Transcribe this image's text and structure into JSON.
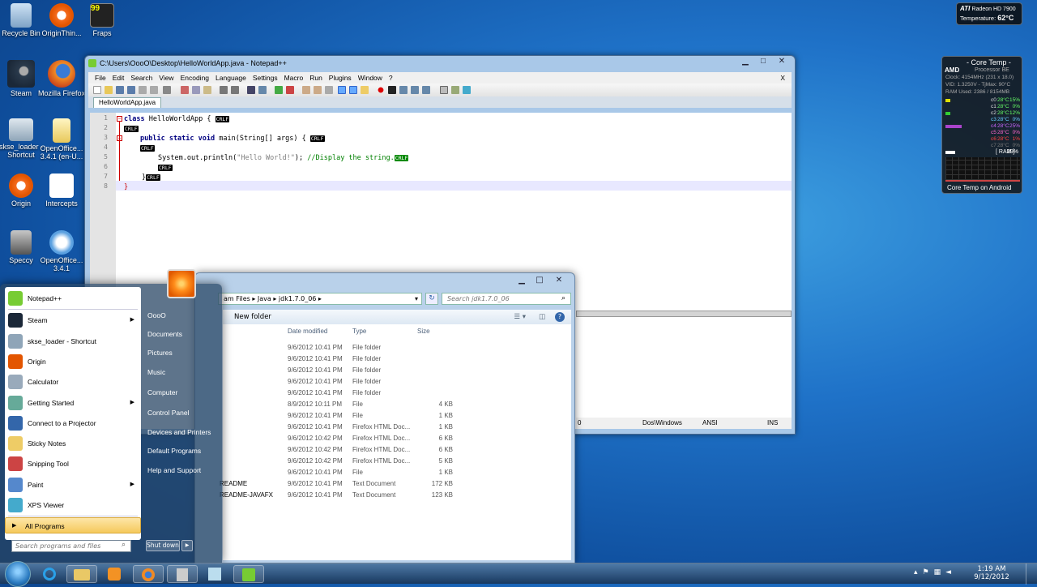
{
  "desktop_icons": [
    {
      "label": "Recycle Bin",
      "icon": "recycle-bin-icon"
    },
    {
      "label": "OriginThin...",
      "icon": "origin-icon"
    },
    {
      "label": "Fraps",
      "icon": "fraps-icon"
    },
    {
      "label": "Steam",
      "icon": "steam-icon"
    },
    {
      "label": "Mozilla Firefox",
      "icon": "firefox-icon"
    },
    {
      "label": "skse_loader - Shortcut",
      "icon": "skse-icon"
    },
    {
      "label": "OpenOffice... 3.4.1 (en-U...",
      "icon": "openoffice-folder-icon"
    },
    {
      "label": "Origin",
      "icon": "origin-icon"
    },
    {
      "label": "Intercepts",
      "icon": "intercepts-icon"
    },
    {
      "label": "Speccy",
      "icon": "speccy-icon"
    },
    {
      "label": "OpenOffice... 3.4.1",
      "icon": "openoffice-icon"
    }
  ],
  "fraps_counter": "99",
  "gpu_gadget": {
    "brand": "ATI",
    "model": "Radeon HD 7900",
    "temp_label": "Temperature:",
    "temp_value": "62°C"
  },
  "coretemp_gadget": {
    "title": "- Core Temp -",
    "processor": "Processor BE",
    "brand": "AMD",
    "clock": "Clock: 4154MHz (231 x 18.0)",
    "vid": "VID: 1.3250V - TjMax: 90°C",
    "ram_used": "RAM Used: 2386 / 8154MB",
    "cores": [
      {
        "name": "c0",
        "temp": "28°C",
        "load": "15%"
      },
      {
        "name": "c1",
        "temp": "28°C",
        "load": "0%"
      },
      {
        "name": "c2",
        "temp": "28°C",
        "load": "12%"
      },
      {
        "name": "c3",
        "temp": "28°C",
        "load": "0%"
      },
      {
        "name": "c4",
        "temp": "28°C",
        "load": "25%"
      },
      {
        "name": "c5",
        "temp": "28°C",
        "load": "0%"
      },
      {
        "name": "c6",
        "temp": "28°C",
        "load": "1%"
      },
      {
        "name": "c7",
        "temp": "28°C",
        "load": "0%"
      }
    ],
    "ram_label": "[ RAM ]",
    "ram_pct": "29%",
    "footer": "Core Temp on Android"
  },
  "notepad": {
    "title": "C:\\Users\\OooO\\Desktop\\HelloWorldApp.java - Notepad++",
    "menu": [
      "File",
      "Edit",
      "Search",
      "View",
      "Encoding",
      "Language",
      "Settings",
      "Macro",
      "Run",
      "Plugins",
      "Window",
      "?"
    ],
    "close_x": "X",
    "tab": "HelloWorldApp.java",
    "line_numbers": [
      "1",
      "2",
      "3",
      "4",
      "5",
      "6",
      "7",
      "8"
    ],
    "code": {
      "l1_kw": "class",
      "l1_rest": " HelloWorldApp {",
      "l3_kw": "public static void",
      "l3_rest": " main(String[] args) {",
      "l5_pre": "System.out.println(",
      "l5_str": "\"Hello World!\"",
      "l5_post": "); ",
      "l5_cmt": "//Display the string.",
      "l6": "}",
      "l7": "}",
      "l8": "}",
      "crlf": "CRLF"
    },
    "status": {
      "lines": "0",
      "eol": "Dos\\Windows",
      "enc": "ANSI",
      "mode": "INS"
    }
  },
  "explorer": {
    "breadcrumb": [
      "am Files",
      "Java",
      "jdk1.7.0_06"
    ],
    "search_placeholder": "Search jdk1.7.0_06",
    "new_folder": "New folder",
    "columns": {
      "date": "Date modified",
      "type": "Type",
      "size": "Size"
    },
    "rows": [
      {
        "name": "",
        "date": "9/6/2012 10:41 PM",
        "type": "File folder",
        "size": ""
      },
      {
        "name": "",
        "date": "9/6/2012 10:41 PM",
        "type": "File folder",
        "size": ""
      },
      {
        "name": "",
        "date": "9/6/2012 10:41 PM",
        "type": "File folder",
        "size": ""
      },
      {
        "name": "",
        "date": "9/6/2012 10:41 PM",
        "type": "File folder",
        "size": ""
      },
      {
        "name": "",
        "date": "9/6/2012 10:41 PM",
        "type": "File folder",
        "size": ""
      },
      {
        "name": "",
        "date": "8/9/2012 10:11 PM",
        "type": "File",
        "size": "4 KB"
      },
      {
        "name": "",
        "date": "9/6/2012 10:41 PM",
        "type": "File",
        "size": "1 KB"
      },
      {
        "name": "",
        "date": "9/6/2012 10:41 PM",
        "type": "Firefox HTML Doc...",
        "size": "1 KB"
      },
      {
        "name": "",
        "date": "9/6/2012 10:42 PM",
        "type": "Firefox HTML Doc...",
        "size": "6 KB"
      },
      {
        "name": "",
        "date": "9/6/2012 10:42 PM",
        "type": "Firefox HTML Doc...",
        "size": "6 KB"
      },
      {
        "name": "",
        "date": "9/6/2012 10:42 PM",
        "type": "Firefox HTML Doc...",
        "size": "5 KB"
      },
      {
        "name": "",
        "date": "9/6/2012 10:41 PM",
        "type": "File",
        "size": "1 KB"
      },
      {
        "name": "README",
        "date": "9/6/2012 10:41 PM",
        "type": "Text Document",
        "size": "172 KB"
      },
      {
        "name": "README-JAVAFX",
        "date": "9/6/2012 10:41 PM",
        "type": "Text Document",
        "size": "123 KB"
      }
    ]
  },
  "start_menu": {
    "programs": [
      {
        "label": "Notepad++",
        "icon": "notepadpp-icon",
        "arrow": false
      },
      {
        "label": "Steam",
        "icon": "steam-icon",
        "arrow": true
      },
      {
        "label": "skse_loader - Shortcut",
        "icon": "skse-icon",
        "arrow": false
      },
      {
        "label": "Origin",
        "icon": "origin-icon",
        "arrow": false
      },
      {
        "label": "Calculator",
        "icon": "calculator-icon",
        "arrow": false
      },
      {
        "label": "Getting Started",
        "icon": "getting-started-icon",
        "arrow": true
      },
      {
        "label": "Connect to a Projector",
        "icon": "projector-icon",
        "arrow": false
      },
      {
        "label": "Sticky Notes",
        "icon": "sticky-notes-icon",
        "arrow": false
      },
      {
        "label": "Snipping Tool",
        "icon": "snipping-tool-icon",
        "arrow": false
      },
      {
        "label": "Paint",
        "icon": "paint-icon",
        "arrow": true
      },
      {
        "label": "XPS Viewer",
        "icon": "xps-viewer-icon",
        "arrow": false
      }
    ],
    "all_programs": "All Programs",
    "search_placeholder": "Search programs and files",
    "right": [
      "OooO",
      "Documents",
      "Pictures",
      "Music",
      "Computer",
      "Control Panel",
      "Devices and Printers",
      "Default Programs",
      "Help and Support"
    ],
    "shutdown": "Shut down"
  },
  "taskbar": {
    "time": "1:19 AM",
    "date": "9/12/2012"
  }
}
